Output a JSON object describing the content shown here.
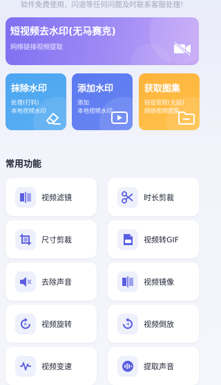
{
  "notice": "软件免费使用，闪退等任何问题及时联系客服处理!",
  "hero": {
    "title": "短视频去水印(无马赛克)",
    "subtitle": "网络链接视频提取",
    "icon": "video-off-icon"
  },
  "cards": [
    {
      "title": "抹除水印",
      "line1": "处理(打码)",
      "line2": "本地视频水印",
      "icon": "eraser-icon",
      "color": "#4ca6f1"
    },
    {
      "title": "添加水印",
      "line1": "添加",
      "line2": "本地视频水印",
      "icon": "video-play-icon",
      "color": "#5a79f0"
    },
    {
      "title": "获取图集",
      "line1": "链接获取(无损)",
      "line2": "网络视频图集",
      "icon": "folder-icon",
      "color": "#ffb33a"
    }
  ],
  "section_title": "常用功能",
  "functions": [
    {
      "label": "视频滤镜",
      "icon": "filter-icon"
    },
    {
      "label": "时长剪裁",
      "icon": "scissors-icon"
    },
    {
      "label": "尺寸剪裁",
      "icon": "crop-icon"
    },
    {
      "label": "视频转GIF",
      "icon": "gif-icon"
    },
    {
      "label": "去除声音",
      "icon": "mute-icon"
    },
    {
      "label": "视频镜像",
      "icon": "mirror-icon"
    },
    {
      "label": "视频旋转",
      "icon": "rotate-icon"
    },
    {
      "label": "视频倒放",
      "icon": "reverse-play-icon"
    },
    {
      "label": "视频变速",
      "icon": "speed-icon"
    },
    {
      "label": "提取声音",
      "icon": "audio-extract-icon"
    }
  ],
  "colors": {
    "accent": "#5a5fe0",
    "icon_bg": "#eef0fc"
  }
}
